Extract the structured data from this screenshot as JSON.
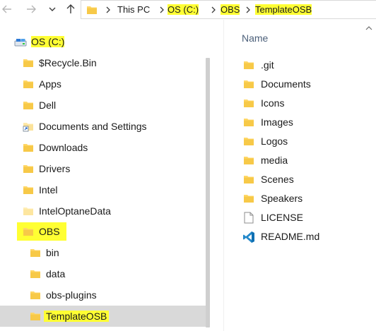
{
  "address_bar": {
    "crumbs": [
      "This PC",
      "OS (C:)",
      "OBS",
      "TemplateOSB"
    ]
  },
  "nav_pane": {
    "items": [
      {
        "label": "OS (C:)",
        "icon": "drive-icon",
        "highlighted": true
      },
      {
        "label": "$Recycle.Bin",
        "icon": "folder-icon"
      },
      {
        "label": "Apps",
        "icon": "folder-icon"
      },
      {
        "label": "Dell",
        "icon": "folder-icon"
      },
      {
        "label": "Documents and Settings",
        "icon": "shortcut-folder-icon"
      },
      {
        "label": "Downloads",
        "icon": "folder-icon"
      },
      {
        "label": "Drivers",
        "icon": "folder-icon"
      },
      {
        "label": "Intel",
        "icon": "folder-icon"
      },
      {
        "label": "IntelOptaneData",
        "icon": "folder-icon"
      },
      {
        "label": "OBS",
        "icon": "folder-icon",
        "highlighted": true
      },
      {
        "label": "bin",
        "icon": "folder-icon"
      },
      {
        "label": "data",
        "icon": "folder-icon"
      },
      {
        "label": "obs-plugins",
        "icon": "folder-icon"
      },
      {
        "label": "TemplateOSB",
        "icon": "folder-icon",
        "highlighted": true,
        "selected": true
      }
    ]
  },
  "content": {
    "column_header": "Name",
    "files": [
      {
        "name": ".git",
        "icon": "folder-icon"
      },
      {
        "name": "Documents",
        "icon": "folder-icon"
      },
      {
        "name": "Icons",
        "icon": "folder-icon"
      },
      {
        "name": "Images",
        "icon": "folder-icon"
      },
      {
        "name": "Logos",
        "icon": "folder-icon"
      },
      {
        "name": "media",
        "icon": "folder-icon"
      },
      {
        "name": "Scenes",
        "icon": "folder-icon"
      },
      {
        "name": "Speakers",
        "icon": "folder-icon"
      },
      {
        "name": "LICENSE",
        "icon": "file-icon"
      },
      {
        "name": "README.md",
        "icon": "vscode-icon"
      }
    ]
  },
  "colors": {
    "highlight": "#ffff33",
    "selected_row": "#d9d9d9",
    "folder": "#ffd766",
    "header_text": "#4c607a"
  }
}
